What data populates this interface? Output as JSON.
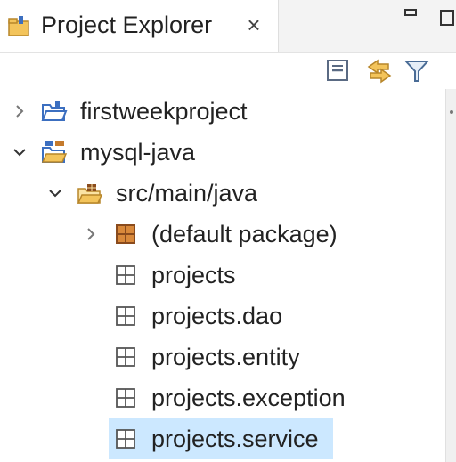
{
  "view": {
    "tab_title": "Project Explorer",
    "tab_close_glyph": "×",
    "tab_icon": "project-explorer-icon"
  },
  "toolbar": {
    "collapse_all": "collapse-all-icon",
    "link_with_editor": "link-with-editor-icon",
    "filter": "filter-icon"
  },
  "colors": {
    "selection": "#cce8ff",
    "folder": "#e8b13a",
    "package": "#8a4b1d",
    "project_blue": "#3c6fc0"
  },
  "tree": [
    {
      "label": "firstweekproject",
      "indent": 0,
      "expanded": false,
      "icon": "open-project-icon"
    },
    {
      "label": "mysql-java",
      "indent": 0,
      "expanded": true,
      "icon": "maven-project-icon"
    },
    {
      "label": "src/main/java",
      "indent": 1,
      "expanded": true,
      "icon": "source-folder-icon"
    },
    {
      "label": "(default package)",
      "indent": 2,
      "expanded": false,
      "icon": "package-icon"
    },
    {
      "label": "projects",
      "indent": 2,
      "icon": "empty-package-icon"
    },
    {
      "label": "projects.dao",
      "indent": 2,
      "icon": "empty-package-icon"
    },
    {
      "label": "projects.entity",
      "indent": 2,
      "icon": "empty-package-icon"
    },
    {
      "label": "projects.exception",
      "indent": 2,
      "icon": "empty-package-icon"
    },
    {
      "label": "projects.service",
      "indent": 2,
      "icon": "empty-package-icon",
      "selected": true
    }
  ]
}
